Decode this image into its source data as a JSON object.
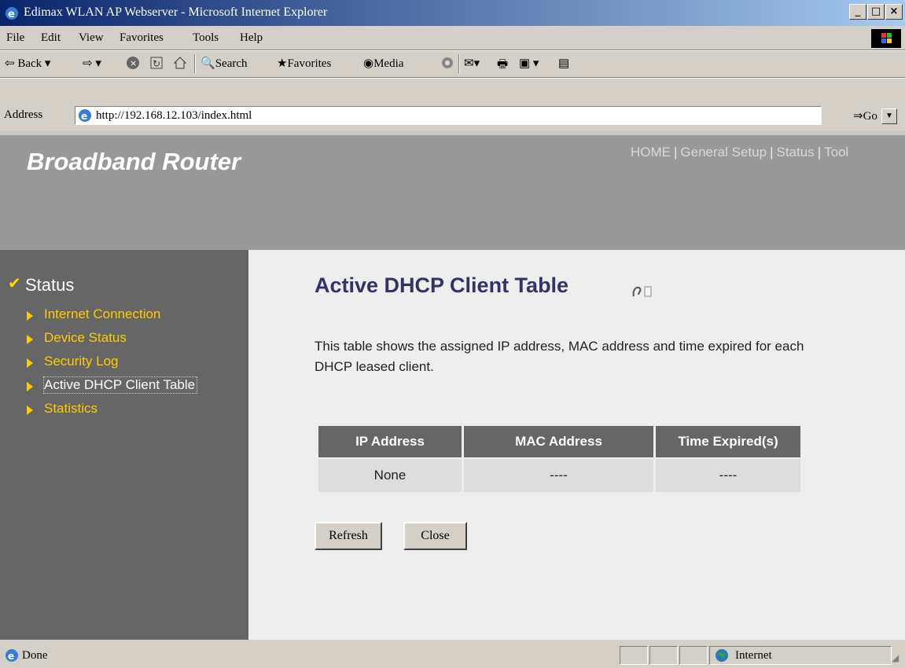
{
  "window": {
    "title": "Edimax WLAN AP Webserver - Microsoft Internet Explorer",
    "buttons": [
      "_",
      "□",
      "×"
    ]
  },
  "menu": {
    "items": [
      "File",
      "Edit",
      "View",
      "Favorites",
      "Tools",
      "Help"
    ]
  },
  "toolbar": {
    "back": "⇦ Back",
    "search": "Search",
    "favorites": "Favorites",
    "media": "Media"
  },
  "address": {
    "label": "Address",
    "url": "http://192.168.12.103/index.html",
    "go": "Go"
  },
  "banner": {
    "brand": "Broadband Router",
    "nav": [
      "HOME",
      "General Setup",
      "Status",
      "Tool"
    ]
  },
  "sidebar": {
    "title": "Status",
    "items": [
      {
        "label": "Internet Connection"
      },
      {
        "label": "Device Status"
      },
      {
        "label": "Security Log"
      },
      {
        "label": "Active DHCP Client Table"
      },
      {
        "label": "Statistics"
      }
    ]
  },
  "content": {
    "title": "Active DHCP Client Table",
    "description": "This table shows the assigned IP address, MAC address and time expired for each DHCP leased client.",
    "table": {
      "headers": [
        "IP Address",
        "MAC Address",
        "Time Expired(s)"
      ],
      "rows": [
        [
          "None",
          "----",
          "----"
        ]
      ]
    },
    "buttons": {
      "refresh": "Refresh",
      "close": "Close"
    }
  },
  "status": {
    "left": "Done",
    "zone": "Internet"
  },
  "colors": {
    "banner": "#999999",
    "sidebar": "#666666",
    "sidebar_link": "#ffcc00",
    "title": "#333366"
  }
}
